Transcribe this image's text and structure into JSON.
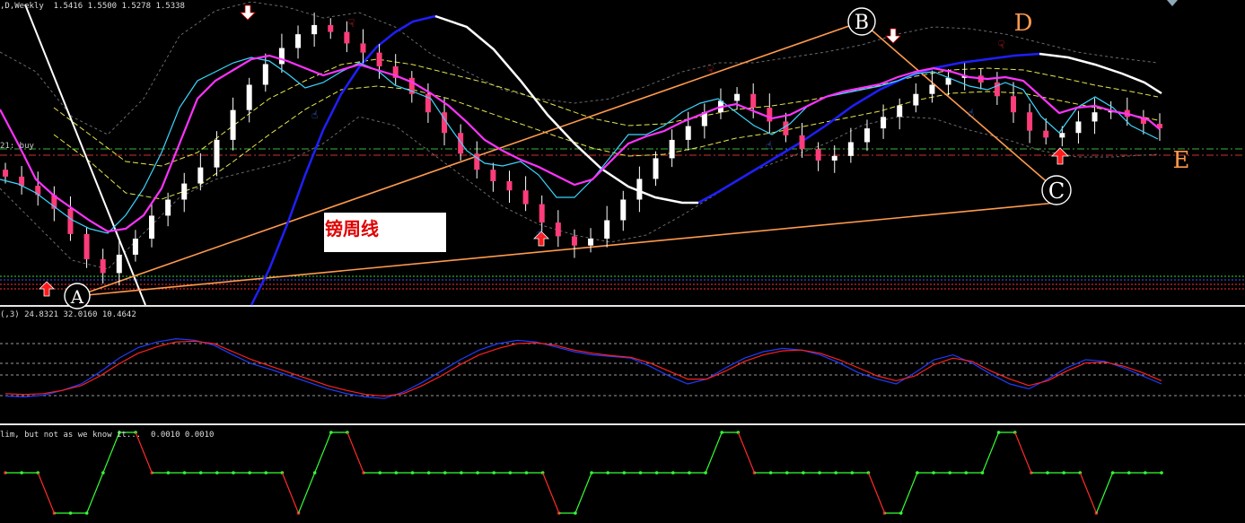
{
  "panels": {
    "main": {
      "symbol_header": ",D,Weekly",
      "ohlc": [
        "1.5416",
        "1.5500",
        "1.5278",
        "1.5338"
      ],
      "order_label": "21: buy",
      "note": "镑周线",
      "wave_labels": {
        "A": "A",
        "B": "B",
        "C": "C",
        "D": "D",
        "E": "E"
      }
    },
    "stochastic": {
      "header": "(,3)",
      "values": [
        "24.8321",
        "32.0160",
        "10.4642"
      ]
    },
    "custom": {
      "header": "lim, but not as we know it...",
      "values": [
        "0.0010",
        "0.0010"
      ]
    }
  },
  "colors": {
    "bull_candle": "#ffffff",
    "bear_candle": "#ff3c7a",
    "wick": "#ffffff",
    "ma_magenta": "#ff33ff",
    "ma_cyan": "#3cd6ff",
    "ma_blue": "#1f1fff",
    "ma_white": "#ffffff",
    "trend_orange": "#ff9a4d",
    "envelope_yellow": "#e8e84a",
    "stoch_main": "#1f3cff",
    "stoch_signal": "#ff2020",
    "osc_up": "#33ff33",
    "osc_down": "#ff2a2a",
    "label_orange": "#ff9a4d",
    "arrow_red": "#ff1a1a"
  },
  "chart_data": [
    {
      "type": "candlestick",
      "title": "",
      "series": [
        {
          "name": "candles",
          "close": [
            1.512,
            1.508,
            1.504,
            1.498,
            1.487,
            1.476,
            1.47,
            1.478,
            1.485,
            1.495,
            1.502,
            1.509,
            1.516,
            1.528,
            1.541,
            1.552,
            1.561,
            1.568,
            1.574,
            1.578,
            1.575,
            1.57,
            1.566,
            1.56,
            1.555,
            1.548,
            1.54,
            1.531,
            1.522,
            1.515,
            1.51,
            1.506,
            1.5,
            1.492,
            1.486,
            1.482,
            1.485,
            1.493,
            1.502,
            1.511,
            1.52,
            1.528,
            1.534,
            1.54,
            1.545,
            1.548,
            1.542,
            1.536,
            1.53,
            1.524,
            1.519,
            1.521,
            1.527,
            1.533,
            1.538,
            1.543,
            1.548,
            1.552,
            1.555,
            1.556,
            1.553,
            1.547,
            1.54,
            1.532,
            1.529,
            1.531,
            1.536,
            1.54,
            1.541,
            1.538,
            1.535,
            1.533
          ]
        }
      ]
    },
    {
      "type": "line",
      "title": "",
      "ylim": [
        0,
        100
      ],
      "series": [
        {
          "name": "",
          "values": [
            15,
            14,
            16,
            22,
            30,
            45,
            62,
            75,
            82,
            86,
            84,
            78,
            66,
            55,
            48,
            40,
            32,
            24,
            18,
            14,
            12,
            20,
            32,
            46,
            60,
            72,
            80,
            84,
            82,
            76,
            70,
            66,
            64,
            62,
            52,
            40,
            30,
            36,
            50,
            62,
            70,
            74,
            72,
            66,
            56,
            44,
            36,
            30,
            44,
            60,
            66,
            56,
            42,
            30,
            24,
            36,
            50,
            60,
            58,
            50,
            40,
            30
          ]
        },
        {
          "name": "",
          "values": [
            18,
            17,
            18,
            22,
            28,
            40,
            55,
            68,
            76,
            82,
            83,
            80,
            70,
            60,
            52,
            44,
            36,
            28,
            22,
            17,
            15,
            18,
            28,
            40,
            54,
            66,
            74,
            80,
            81,
            78,
            72,
            68,
            65,
            63,
            56,
            46,
            36,
            36,
            46,
            58,
            66,
            71,
            72,
            68,
            60,
            50,
            40,
            34,
            40,
            54,
            62,
            58,
            46,
            36,
            28,
            34,
            46,
            56,
            57,
            52,
            44,
            34
          ]
        }
      ]
    },
    {
      "type": "line",
      "title": "",
      "series": [
        {
          "name": "",
          "values": [
            0,
            0,
            0,
            -1,
            -1,
            -1,
            0,
            1,
            1,
            0,
            0,
            0,
            0,
            0,
            0,
            0,
            0,
            0,
            -1,
            0,
            1,
            1,
            0,
            0,
            0,
            0,
            0,
            0,
            0,
            0,
            0,
            0,
            0,
            0,
            -1,
            -1,
            0,
            0,
            0,
            0,
            0,
            0,
            0,
            0,
            1,
            1,
            0,
            0,
            0,
            0,
            0,
            0,
            0,
            0,
            -1,
            -1,
            0,
            0,
            0,
            0,
            0,
            1,
            1,
            0,
            0,
            0,
            0,
            -1,
            0,
            0,
            0,
            0
          ]
        }
      ]
    }
  ]
}
